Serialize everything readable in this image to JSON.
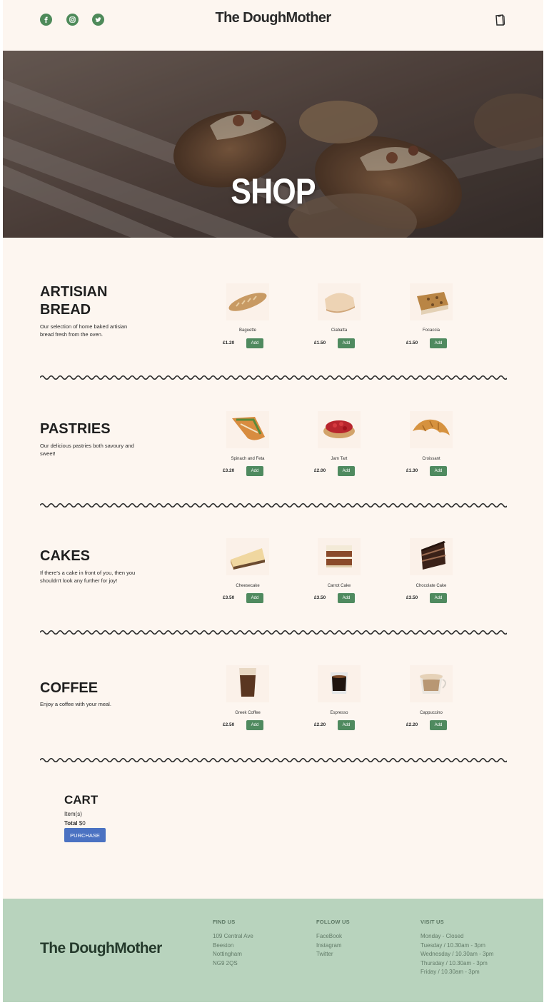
{
  "header": {
    "brand": "The DoughMother",
    "social_icons": [
      "facebook-icon",
      "instagram-icon",
      "twitter-icon"
    ],
    "cart_icon": "shopping-bag-icon"
  },
  "hero": {
    "title": "SHOP"
  },
  "sections": [
    {
      "title": "ARTISIAN BREAD",
      "description": "Our selection of home baked artisian bread fresh from the oven.",
      "products": [
        {
          "name": "Baguette",
          "price": "£1.20",
          "add_label": "Add"
        },
        {
          "name": "Ciabatta",
          "price": "£1.50",
          "add_label": "Add"
        },
        {
          "name": "Focaccia",
          "price": "£1.50",
          "add_label": "Add"
        }
      ]
    },
    {
      "title": "PASTRIES",
      "description": "Our delicious pastries both savoury and sweet!",
      "products": [
        {
          "name": "Spinach and Feta",
          "price": "£3.20",
          "add_label": "Add"
        },
        {
          "name": "Jam Tart",
          "price": "£2.00",
          "add_label": "Add"
        },
        {
          "name": "Croissant",
          "price": "£1.30",
          "add_label": "Add"
        }
      ]
    },
    {
      "title": "CAKES",
      "description": "If there's a cake in front of you, then you shouldn't look any further for joy!",
      "products": [
        {
          "name": "Cheesecake",
          "price": "£3.50",
          "add_label": "Add"
        },
        {
          "name": "Carrot Cake",
          "price": "£3.50",
          "add_label": "Add"
        },
        {
          "name": "Chocolate Cake",
          "price": "£3.50",
          "add_label": "Add"
        }
      ]
    },
    {
      "title": "COFFEE",
      "description": "Enjoy a coffee with your meal.",
      "products": [
        {
          "name": "Greek Coffee",
          "price": "£2.50",
          "add_label": "Add"
        },
        {
          "name": "Espresso",
          "price": "£2.20",
          "add_label": "Add"
        },
        {
          "name": "Cappuccino",
          "price": "£2.20",
          "add_label": "Add"
        }
      ]
    }
  ],
  "cart": {
    "title": "CART",
    "items_label": "Item(s)",
    "total_label": "Total",
    "total_value": "$0",
    "purchase_label": "PURCHASE"
  },
  "footer": {
    "brand": "The DoughMother",
    "find_us": {
      "heading": "FIND US",
      "lines": [
        "109 Central Ave",
        "Beeston",
        "Nottingham",
        "NG9 2QS"
      ]
    },
    "follow_us": {
      "heading": "FOLLOW US",
      "lines": [
        "FaceBook",
        "Instagram",
        "Twitter"
      ]
    },
    "visit_us": {
      "heading": "VISIT US",
      "lines": [
        "Monday - Closed",
        "Tuesday / 10.30am - 3pm",
        "Wednesday / 10.30am - 3pm",
        "Thursday / 10.30am - 3pm",
        "Friday / 10.30am - 3pm"
      ]
    }
  },
  "colors": {
    "background": "#fdf6f0",
    "accent_green": "#4f8a5f",
    "purchase_blue": "#4b72c2",
    "footer_green": "#b8d3bd"
  }
}
